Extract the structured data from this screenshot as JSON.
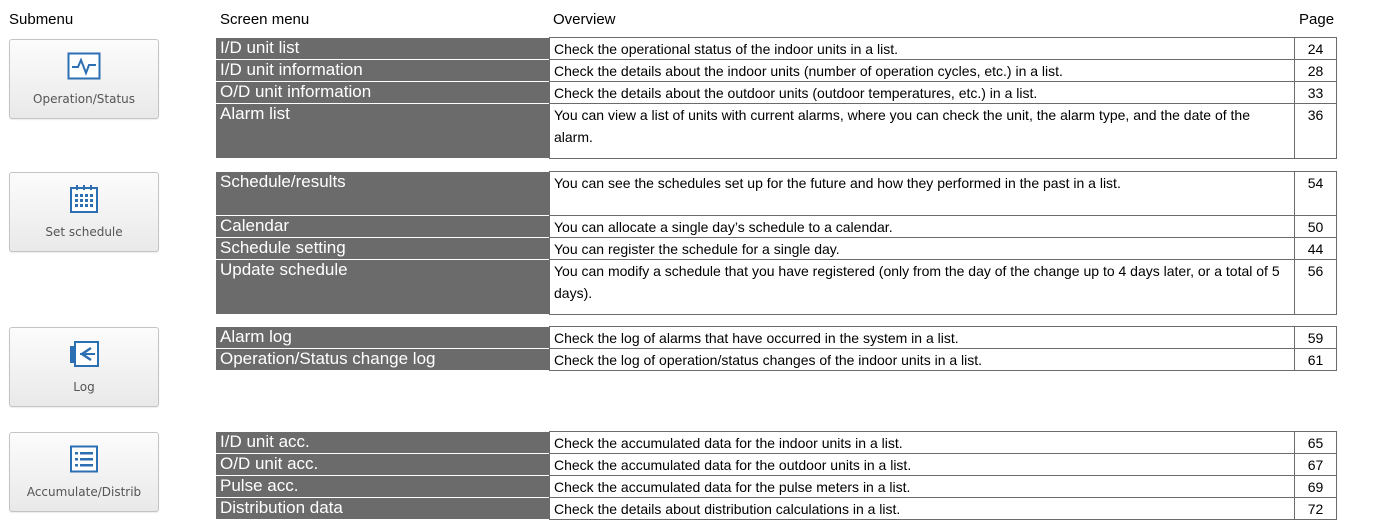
{
  "headers": {
    "submenu": "Submenu",
    "screen_menu": "Screen menu",
    "overview": "Overview",
    "page": "Page"
  },
  "submenus": [
    {
      "label": "Operation/Status",
      "icon": "pulse-icon"
    },
    {
      "label": "Set schedule",
      "icon": "calendar-icon"
    },
    {
      "label": "Log",
      "icon": "log-icon"
    },
    {
      "label": "Accumulate/Distrib",
      "icon": "list-icon"
    }
  ],
  "rows": [
    {
      "menu": "I/D unit list",
      "overview": "Check the operational status of the indoor units in a list.",
      "page": "24"
    },
    {
      "menu": "I/D unit information",
      "overview": "Check the details about the indoor units (number of operation cycles, etc.) in a list.",
      "page": "28"
    },
    {
      "menu": "O/D unit information",
      "overview": "Check the details about the outdoor units (outdoor temperatures, etc.) in a list.",
      "page": "33"
    },
    {
      "menu": "Alarm list",
      "overview": "You can view a list of units with current alarms, where you can check the unit, the alarm type, and the date of the alarm.",
      "page": "36"
    },
    {
      "menu": "Schedule/results",
      "overview": "You can see the schedules set up for the future and how they performed in the past in a list.",
      "page": "54"
    },
    {
      "menu": "Calendar",
      "overview": "You can allocate a single day’s schedule to a calendar.",
      "page": "50"
    },
    {
      "menu": "Schedule setting",
      "overview": "You can register the schedule for a single day.",
      "page": "44"
    },
    {
      "menu": "Update schedule",
      "overview": "You can modify a schedule that you have registered (only from the day of the change up to 4 days later, or a total of 5 days).",
      "page": "56"
    },
    {
      "menu": "Alarm log",
      "overview": "Check the log of alarms that have occurred in the system in a list.",
      "page": "59"
    },
    {
      "menu": "Operation/Status change log",
      "overview": "Check the log of operation/status changes of the indoor units in a list.",
      "page": "61"
    },
    {
      "menu": "I/D unit acc.",
      "overview": "Check the accumulated data for the indoor units in a list.",
      "page": "65"
    },
    {
      "menu": "O/D unit acc.",
      "overview": "Check the accumulated data for the outdoor units in a list.",
      "page": "67"
    },
    {
      "menu": "Pulse acc.",
      "overview": "Check the accumulated data for the pulse meters in a list.",
      "page": "69"
    },
    {
      "menu": "Distribution data",
      "overview": "Check the details about distribution calculations in a list.",
      "page": "72"
    }
  ],
  "colors": {
    "menu_bg": "#6b6b6b",
    "icon_blue": "#2d6fb3"
  }
}
